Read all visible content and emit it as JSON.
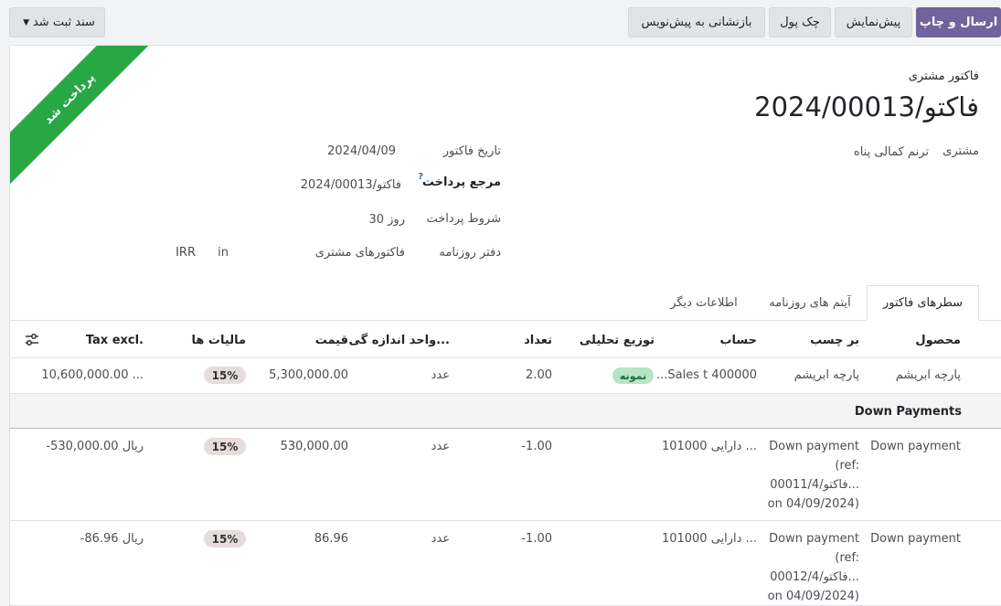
{
  "toolbar": {
    "send_print": "ارسال و چاپ",
    "preview": "پیش‌نمایش",
    "check": "چک پول",
    "reset_draft": "بازنشانی به پیش‌نویس",
    "journal_entry": "سند ثبت شد"
  },
  "ribbon": {
    "label": "پرداخت شد",
    "color": "#28a745"
  },
  "invoice": {
    "type_label": "فاکتور مشتری",
    "number": "فاکتو/2024/00013",
    "customer_label": "مشتری",
    "customer_value": "ترنم کمالی پناه",
    "date_label": "تاریخ فاکتور",
    "date_value": "2024/04/09",
    "payment_ref_label": "مرجع پرداخت",
    "payment_ref_help": "?",
    "payment_ref_value": "فاکتو/2024/00013",
    "terms_label": "شروط پرداخت",
    "terms_value": "30 روز",
    "journal_label": "دفتر روزنامه",
    "journal_value": "فاکتورهای مشتری",
    "journal_in": "in",
    "currency": "IRR"
  },
  "tabs": [
    {
      "label": "سطرهای فاکتور"
    },
    {
      "label": "آیتم های روزنامه"
    },
    {
      "label": "اطلاعات دیگر"
    }
  ],
  "table": {
    "headers": {
      "product": "محصول",
      "label": "بر چسب",
      "account": "حساب",
      "analytic": "توزیع تحلیلی",
      "qty": "تعداد",
      "uom": "واحد اندازه گی...",
      "price": "قیمت",
      "taxes": "مالیات ها",
      "subtotal": "Tax excl."
    },
    "row1": {
      "product": "پارچه ابریشم",
      "label": "پارچه ابریشم",
      "account": "400000 Sales t...",
      "analytic": "نمونه",
      "qty": "2.00",
      "uom": "عدد",
      "price": "5,300,000.00",
      "tax": "15%",
      "subtotal": "10,600,000.00 ..."
    },
    "section": "Down Payments",
    "row2": {
      "product": "Down payment",
      "label_lines": [
        "Down payment",
        "(ref:",
        "فاکتو/00011/4...",
        "on 04/09/2024)"
      ],
      "account": "101000 دارایی ...",
      "qty": "-1.00",
      "uom": "عدد",
      "price": "530,000.00",
      "tax": "15%",
      "subtotal": "-530,000.00 ریال"
    },
    "row3": {
      "product": "Down payment",
      "label_lines": [
        "Down payment",
        "(ref:",
        "فاکتو/00012/4...",
        "on 04/09/2024)"
      ],
      "account": "101000 دارایی ...",
      "qty": "-1.00",
      "uom": "عدد",
      "price": "86.96",
      "tax": "15%",
      "subtotal": "-86.96 ریال"
    }
  },
  "icons": {
    "column_settings": "sliders-icon",
    "dropdown": "caret-down-icon"
  },
  "colors": {
    "primary": "#71639e",
    "paid": "#28a745",
    "analytic_badge": "#b7e4c7"
  }
}
